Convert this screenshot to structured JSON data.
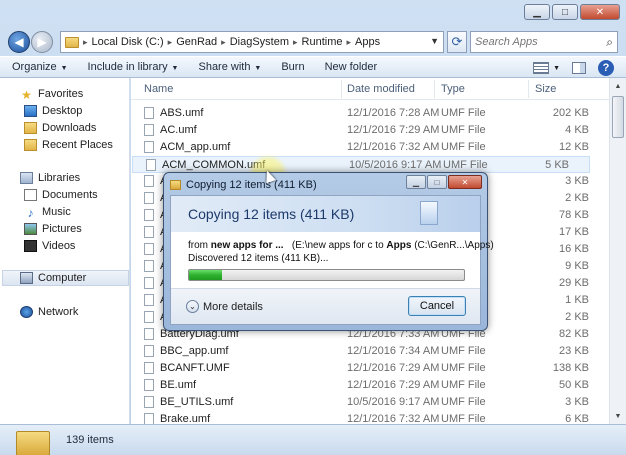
{
  "window": {
    "caption_buttons": [
      "minimize",
      "maximize",
      "close"
    ]
  },
  "address": {
    "crumbs": [
      "Local Disk (C:)",
      "GenRad",
      "DiagSystem",
      "Runtime",
      "Apps"
    ],
    "search_placeholder": "Search Apps"
  },
  "toolbar": {
    "organize": "Organize",
    "include": "Include in library",
    "share": "Share with",
    "burn": "Burn",
    "new_folder": "New folder"
  },
  "nav": {
    "favorites": "Favorites",
    "desktop": "Desktop",
    "downloads": "Downloads",
    "recent": "Recent Places",
    "libraries": "Libraries",
    "documents": "Documents",
    "music": "Music",
    "pictures": "Pictures",
    "videos": "Videos",
    "computer": "Computer",
    "network": "Network"
  },
  "columns": {
    "name": "Name",
    "date": "Date modified",
    "type": "Type",
    "size": "Size"
  },
  "files": [
    {
      "name": "ABS.umf",
      "date": "12/1/2016 7:28 AM",
      "type": "UMF File",
      "size": "202 KB"
    },
    {
      "name": "AC.umf",
      "date": "12/1/2016 7:29 AM",
      "type": "UMF File",
      "size": "4 KB"
    },
    {
      "name": "ACM_app.umf",
      "date": "12/1/2016 7:32 AM",
      "type": "UMF File",
      "size": "12 KB"
    },
    {
      "name": "ACM_COMMON.umf",
      "date": "10/5/2016 9:17 AM",
      "type": "UMF File",
      "size": "5 KB"
    },
    {
      "name": "A",
      "date": "",
      "type": "",
      "size": "3 KB"
    },
    {
      "name": "A",
      "date": "",
      "type": "",
      "size": "2 KB"
    },
    {
      "name": "A",
      "date": "",
      "type": "",
      "size": "78 KB"
    },
    {
      "name": "A",
      "date": "",
      "type": "",
      "size": "17 KB"
    },
    {
      "name": "A",
      "date": "",
      "type": "",
      "size": "16 KB"
    },
    {
      "name": "A",
      "date": "",
      "type": "",
      "size": "9 KB"
    },
    {
      "name": "A",
      "date": "",
      "type": "",
      "size": "29 KB"
    },
    {
      "name": "A",
      "date": "",
      "type": "",
      "size": "1 KB"
    },
    {
      "name": "A",
      "date": "",
      "type": "",
      "size": "2 KB"
    },
    {
      "name": "BatteryDiag.umf",
      "date": "12/1/2016 7:33 AM",
      "type": "UMF File",
      "size": "82 KB"
    },
    {
      "name": "BBC_app.umf",
      "date": "12/1/2016 7:34 AM",
      "type": "UMF File",
      "size": "23 KB"
    },
    {
      "name": "BCANFT.UMF",
      "date": "12/1/2016 7:29 AM",
      "type": "UMF File",
      "size": "138 KB"
    },
    {
      "name": "BE.umf",
      "date": "12/1/2016 7:29 AM",
      "type": "UMF File",
      "size": "50 KB"
    },
    {
      "name": "BE_UTILS.umf",
      "date": "10/5/2016 9:17 AM",
      "type": "UMF File",
      "size": "3 KB"
    },
    {
      "name": "Brake.umf",
      "date": "12/1/2016 7:32 AM",
      "type": "UMF File",
      "size": "6 KB"
    }
  ],
  "status": {
    "count": "139 items"
  },
  "dialog": {
    "title": "Copying 12 items (411 KB)",
    "heading": "Copying 12 items (411 KB)",
    "from_word": "from",
    "from_src": "new apps for ...",
    "from_path": "(E:\\new apps for c",
    "to_word": "to",
    "to_dst": "Apps",
    "to_path": "(C:\\GenR...\\Apps)",
    "discovered": "Discovered 12 items (411 KB)...",
    "progress": 0.12,
    "more_details": "More details",
    "cancel": "Cancel"
  },
  "colors": {
    "progress_green": "#2fb12f",
    "accent_blue": "#1d3a6b"
  }
}
